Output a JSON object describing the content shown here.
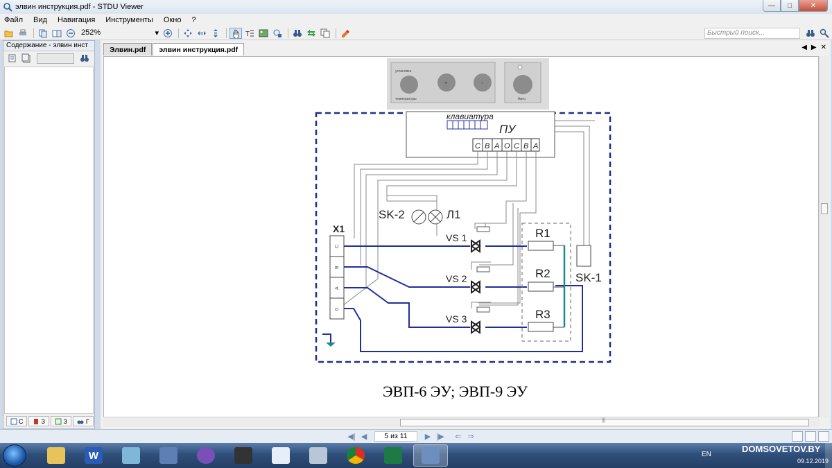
{
  "window": {
    "title": "элвин  инструкция.pdf - STDU Viewer"
  },
  "menu": [
    {
      "label": "Файл"
    },
    {
      "label": "Вид"
    },
    {
      "label": "Навигация"
    },
    {
      "label": "Инструменты"
    },
    {
      "label": "Окно"
    },
    {
      "label": "?"
    }
  ],
  "toolbar": {
    "zoom": "252%",
    "search_placeholder": "Быстрый поиск..."
  },
  "sidebar": {
    "title": "Содержание - элвин  инст"
  },
  "tabs": [
    {
      "label": "Элвин.pdf",
      "active": false
    },
    {
      "label": "элвин  инструкция.pdf",
      "active": true
    }
  ],
  "document": {
    "caption": "ЭВП-6 ЭУ; ЭВП-9 ЭУ",
    "diagram": {
      "keyboard_label": "клавиатура",
      "pu_label": "ПУ",
      "terminal_letters": [
        "С",
        "В",
        "А",
        "О",
        "С",
        "В",
        "А"
      ],
      "panel_labels": [
        "установка",
        "температуры",
        "Авто"
      ],
      "panel_button_marks": [
        "+",
        "-"
      ],
      "x1_label": "X1",
      "x1_pins": [
        "С",
        "В",
        "А",
        "0"
      ],
      "sk2_label": "SK-2",
      "lamp_label": "Л1",
      "triacs": [
        "VS 1",
        "VS 2",
        "VS 3"
      ],
      "resistors": [
        "R1",
        "R2",
        "R3"
      ],
      "sk1_label": "SK-1"
    }
  },
  "status": {
    "page_indicator": "5 из 11"
  },
  "taskbar": {
    "lang": "EN",
    "watermark": "DOMSOVETOV.BY",
    "date": "09.12.2019",
    "word_icon": "W"
  }
}
